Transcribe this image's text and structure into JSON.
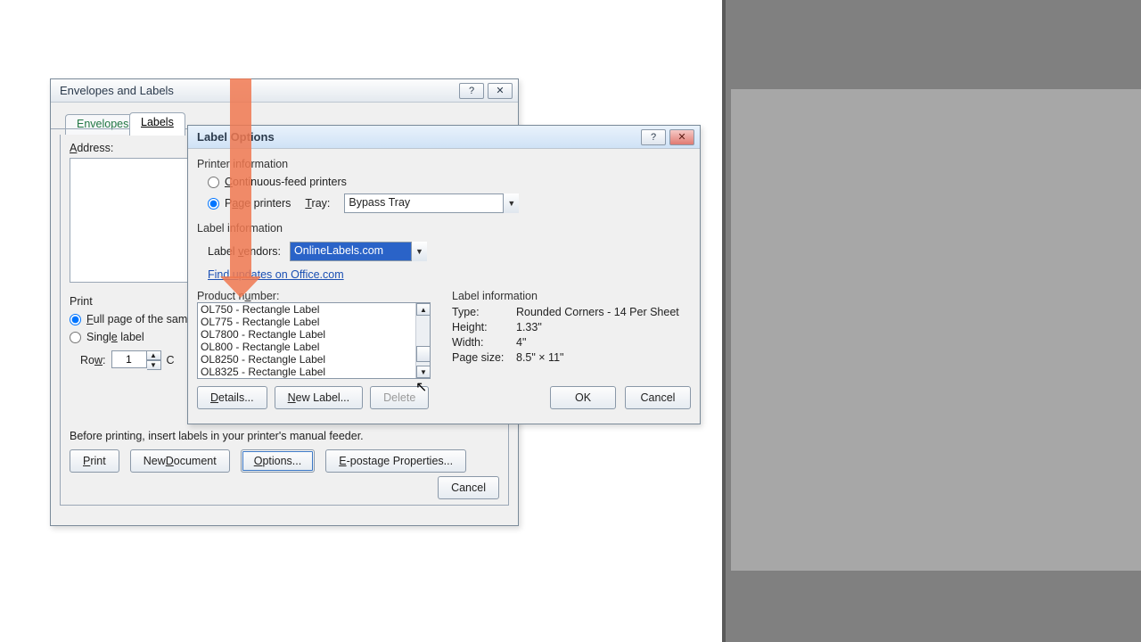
{
  "env": {
    "title": "Envelopes and Labels",
    "tabs": {
      "envelopes": "Envelopes",
      "labels": "Labels"
    },
    "address_label": "Address:",
    "print_group": "Print",
    "radio_full": "Full page of the sam",
    "radio_single": "Single label",
    "row_label": "Row:",
    "row_value": "1",
    "col_hint": "C",
    "note": "Before printing, insert labels in your printer's manual feeder.",
    "buttons": {
      "print": "Print",
      "newdoc": "New Document",
      "options": "Options...",
      "epost": "E-postage Properties...",
      "cancel": "Cancel"
    }
  },
  "opt": {
    "title": "Label Options",
    "printer_info": "Printer information",
    "radio_cont": "Continuous-feed printers",
    "radio_page": "Page printers",
    "tray_label": "Tray:",
    "tray_value": "Bypass Tray",
    "label_info_hdr": "Label information",
    "vendor_label": "Label vendors:",
    "vendor_value": "OnlineLabels.com",
    "update_link": "Find updates on Office.com",
    "product_label": "Product number:",
    "products": [
      "OL750 - Rectangle Label",
      "OL775 - Rectangle Label",
      "OL7800 - Rectangle Label",
      "OL800 - Rectangle Label",
      "OL8250 - Rectangle Label",
      "OL8325 - Rectangle Label"
    ],
    "info_hdr": "Label information",
    "info": {
      "type_k": "Type:",
      "type_v": "Rounded Corners - 14 Per Sheet",
      "height_k": "Height:",
      "height_v": "1.33\"",
      "width_k": "Width:",
      "width_v": "4\"",
      "page_k": "Page size:",
      "page_v": "8.5\" × 11\""
    },
    "buttons": {
      "details": "Details...",
      "newlabel": "New Label...",
      "delete": "Delete",
      "ok": "OK",
      "cancel": "Cancel"
    }
  }
}
